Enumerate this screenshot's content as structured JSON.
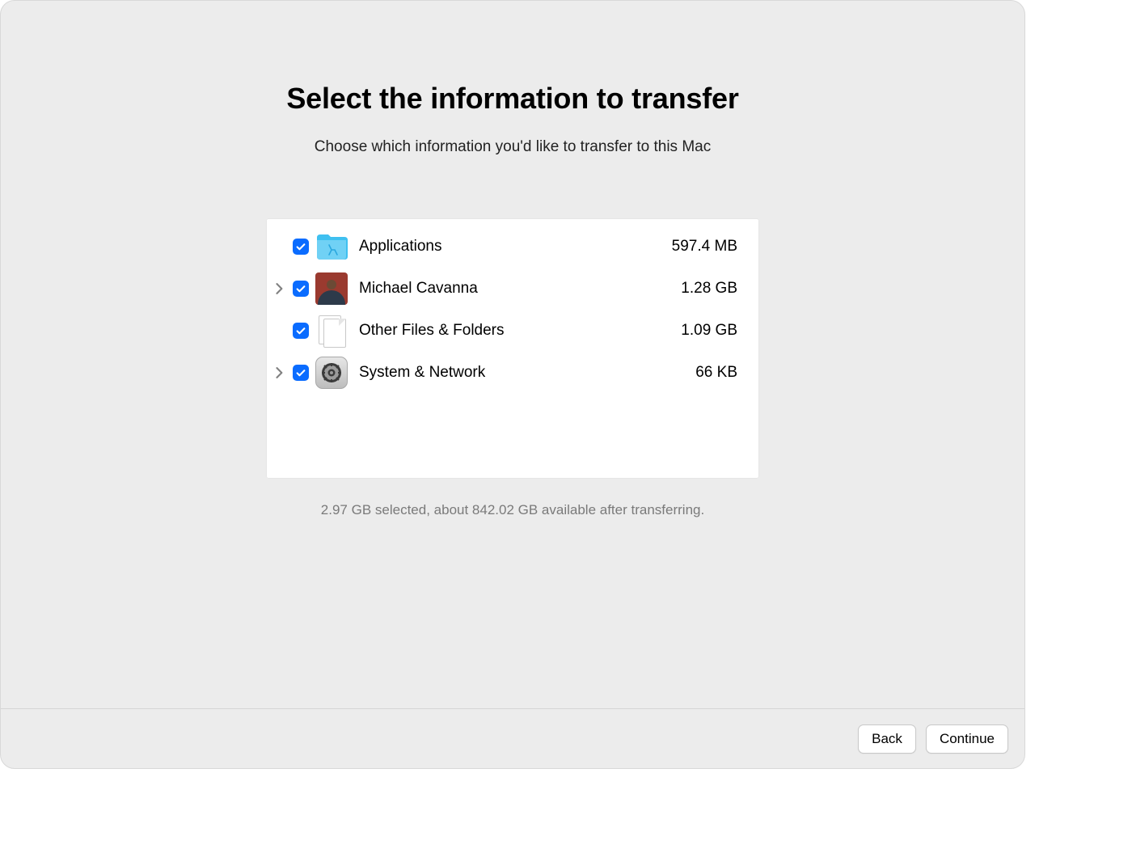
{
  "heading": "Select the information to transfer",
  "subheading": "Choose which information you'd like to transfer to this Mac",
  "items": [
    {
      "label": "Applications",
      "size": "597.4 MB",
      "icon": "applications-folder-icon",
      "expandable": false,
      "checked": true
    },
    {
      "label": "Michael Cavanna",
      "size": "1.28 GB",
      "icon": "user-avatar-icon",
      "expandable": true,
      "checked": true
    },
    {
      "label": "Other Files & Folders",
      "size": "1.09 GB",
      "icon": "documents-icon",
      "expandable": false,
      "checked": true
    },
    {
      "label": "System & Network",
      "size": "66 KB",
      "icon": "system-settings-icon",
      "expandable": true,
      "checked": true
    }
  ],
  "status": "2.97 GB selected, about 842.02 GB available after transferring.",
  "footer": {
    "back": "Back",
    "continue": "Continue"
  }
}
